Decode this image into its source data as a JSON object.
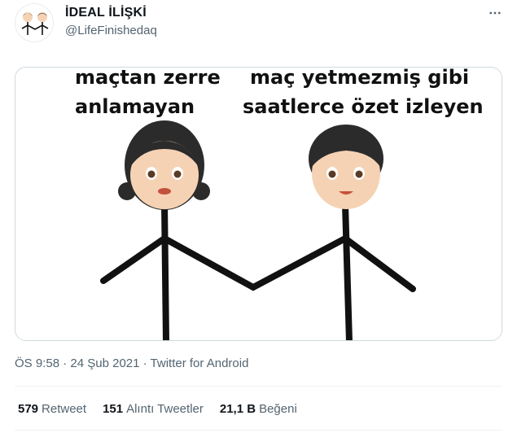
{
  "author": {
    "display_name": "İDEAL İLİŞKİ",
    "handle": "@LifeFinishedaq"
  },
  "icons": {
    "avatar": "couple-avatar-icon",
    "more": "more-options-icon"
  },
  "media": {
    "left_caption": [
      "maçtan zerre",
      "anlamayan"
    ],
    "right_caption": [
      "maç yetmezmiş gibi",
      "saatlerce özet izleyen"
    ]
  },
  "meta": {
    "time": "ÖS 9:58",
    "separator": "·",
    "date": "24 Şub 2021",
    "source": "Twitter for Android"
  },
  "stats": {
    "retweets_count": "579",
    "retweets_label": "Retweet",
    "quotes_count": "151",
    "quotes_label": "Alıntı Tweetler",
    "likes_count": "21,1 B",
    "likes_label": "Beğeni"
  },
  "colors": {
    "text_primary": "#0f1419",
    "text_secondary": "#536471",
    "border": "#cfd9de",
    "skin": "#f6d2b4",
    "hair": "#2b2b2b"
  }
}
